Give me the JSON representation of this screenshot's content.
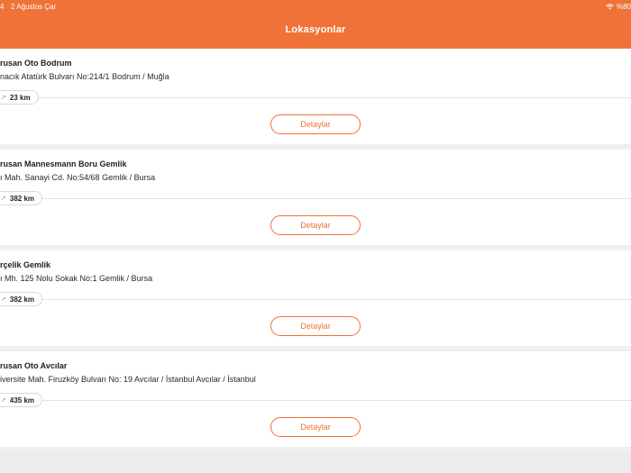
{
  "status_bar": {
    "time": "4",
    "date": "2 Ağustos Çar",
    "battery": "%80"
  },
  "header": {
    "title": "Lokasyonlar"
  },
  "locations": [
    {
      "name": "rusan Oto Bodrum",
      "address": "nacık Atatürk Bulvarı No:214/1  Bodrum / Muğla",
      "distance": "23 km",
      "button": "Detaylar"
    },
    {
      "name": "rusan Mannesmann Boru Gemlik",
      "address": "ı Mah. Sanayi Cd. No:54/68  Gemlik / Bursa",
      "distance": "382 km",
      "button": "Detaylar"
    },
    {
      "name": "rçelik Gemlik",
      "address": "ı Mh. 125 Nolu Sokak No:1  Gemlik / Bursa",
      "distance": "382 km",
      "button": "Detaylar"
    },
    {
      "name": "rusan Oto Avcılar",
      "address": "iversite Mah. Firuzköy Bulvarı No: 19 Avcılar / İstanbul  Avcılar / İstanbul",
      "distance": "435 km",
      "button": "Detaylar"
    }
  ],
  "icons": {
    "wifi": "wifi-icon",
    "pin": "location-pin-icon"
  },
  "colors": {
    "accent": "#ef7238",
    "background": "#ececee",
    "card": "#ffffff"
  }
}
